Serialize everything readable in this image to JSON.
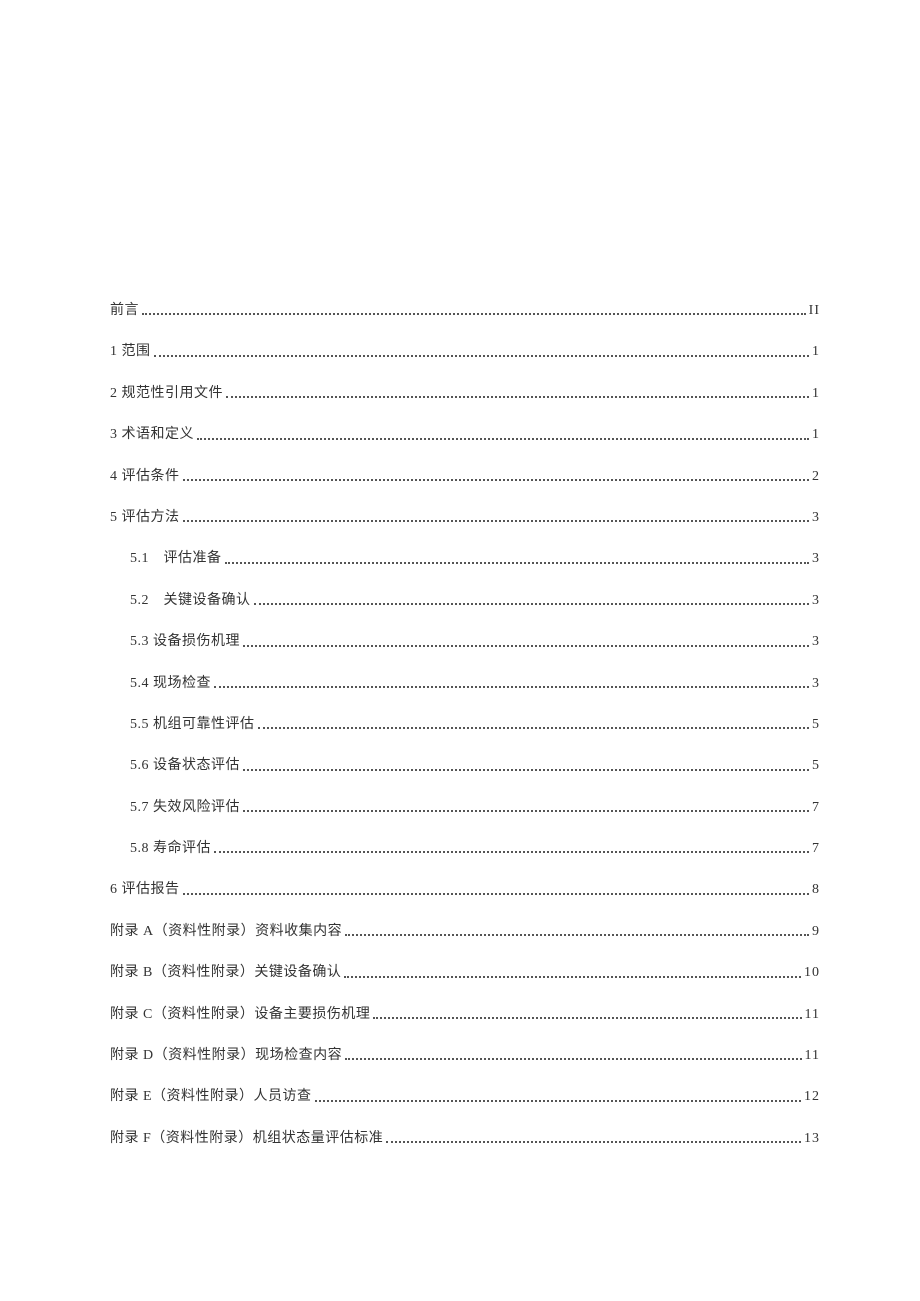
{
  "toc": [
    {
      "title": "前言",
      "page": "II",
      "indent": false
    },
    {
      "title": "1 范围",
      "page": "1",
      "indent": false
    },
    {
      "title": "2 规范性引用文件",
      "page": "1",
      "indent": false
    },
    {
      "title": "3 术语和定义",
      "page": "1",
      "indent": false
    },
    {
      "title": "4 评估条件",
      "page": "2",
      "indent": false
    },
    {
      "title": "5 评估方法",
      "page": "3",
      "indent": false
    },
    {
      "title": "5.1　评估准备",
      "page": "3",
      "indent": true
    },
    {
      "title": "5.2　关键设备确认",
      "page": "3",
      "indent": true
    },
    {
      "title": "5.3 设备损伤机理",
      "page": "3",
      "indent": true
    },
    {
      "title": "5.4 现场检查",
      "page": "3",
      "indent": true
    },
    {
      "title": "5.5 机组可靠性评估",
      "page": "5",
      "indent": true
    },
    {
      "title": "5.6 设备状态评估",
      "page": "5",
      "indent": true
    },
    {
      "title": "5.7 失效风险评估",
      "page": "7",
      "indent": true
    },
    {
      "title": "5.8 寿命评估",
      "page": "7",
      "indent": true
    },
    {
      "title": "6 评估报告",
      "page": "8",
      "indent": false
    },
    {
      "title": "附录 A（资料性附录）资料收集内容",
      "page": "9",
      "indent": false
    },
    {
      "title": "附录 B（资料性附录）关键设备确认",
      "page": "10",
      "indent": false
    },
    {
      "title": "附录 C（资料性附录）设备主要损伤机理",
      "page": "11",
      "indent": false
    },
    {
      "title": "附录 D（资料性附录）现场检查内容",
      "page": "11",
      "indent": false
    },
    {
      "title": "附录 E（资料性附录）人员访查",
      "page": "12",
      "indent": false
    },
    {
      "title": "附录 F（资料性附录）机组状态量评估标准",
      "page": "13",
      "indent": false
    }
  ]
}
